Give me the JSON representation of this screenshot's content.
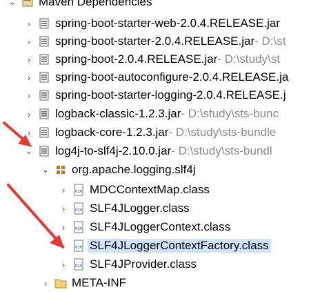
{
  "tree": {
    "root": {
      "label": "Maven Dependencies"
    },
    "jars": [
      {
        "label": "spring-boot-starter-web-2.0.4.RELEASE.jar",
        "path": ""
      },
      {
        "label": "spring-boot-starter-2.0.4.RELEASE.jar",
        "path": " - D:\\st"
      },
      {
        "label": "spring-boot-2.0.4.RELEASE.jar",
        "path": " - D:\\study\\st"
      },
      {
        "label": "spring-boot-autoconfigure-2.0.4.RELEASE.ja",
        "path": ""
      },
      {
        "label": "spring-boot-starter-logging-2.0.4.RELEASE.j",
        "path": ""
      },
      {
        "label": "logback-classic-1.2.3.jar",
        "path": " - D:\\study\\sts-bunc"
      },
      {
        "label": "logback-core-1.2.3.jar",
        "path": " - D:\\study\\sts-bundle"
      },
      {
        "label": "log4j-to-slf4j-2.10.0.jar",
        "path": " - D:\\study\\sts-bundl"
      }
    ],
    "package": {
      "label": "org.apache.logging.slf4j"
    },
    "classes": [
      {
        "label": "MDCContextMap.class"
      },
      {
        "label": "SLF4JLogger.class"
      },
      {
        "label": "SLF4JLoggerContext.class"
      },
      {
        "label": "SLF4JLoggerContextFactory.class"
      },
      {
        "label": "SLF4JProvider.class"
      }
    ],
    "meta": {
      "label": "META-INF"
    }
  },
  "colors": {
    "selection": "#cfe3f8",
    "arrow": "#e53935",
    "path": "#8a8a8a"
  }
}
